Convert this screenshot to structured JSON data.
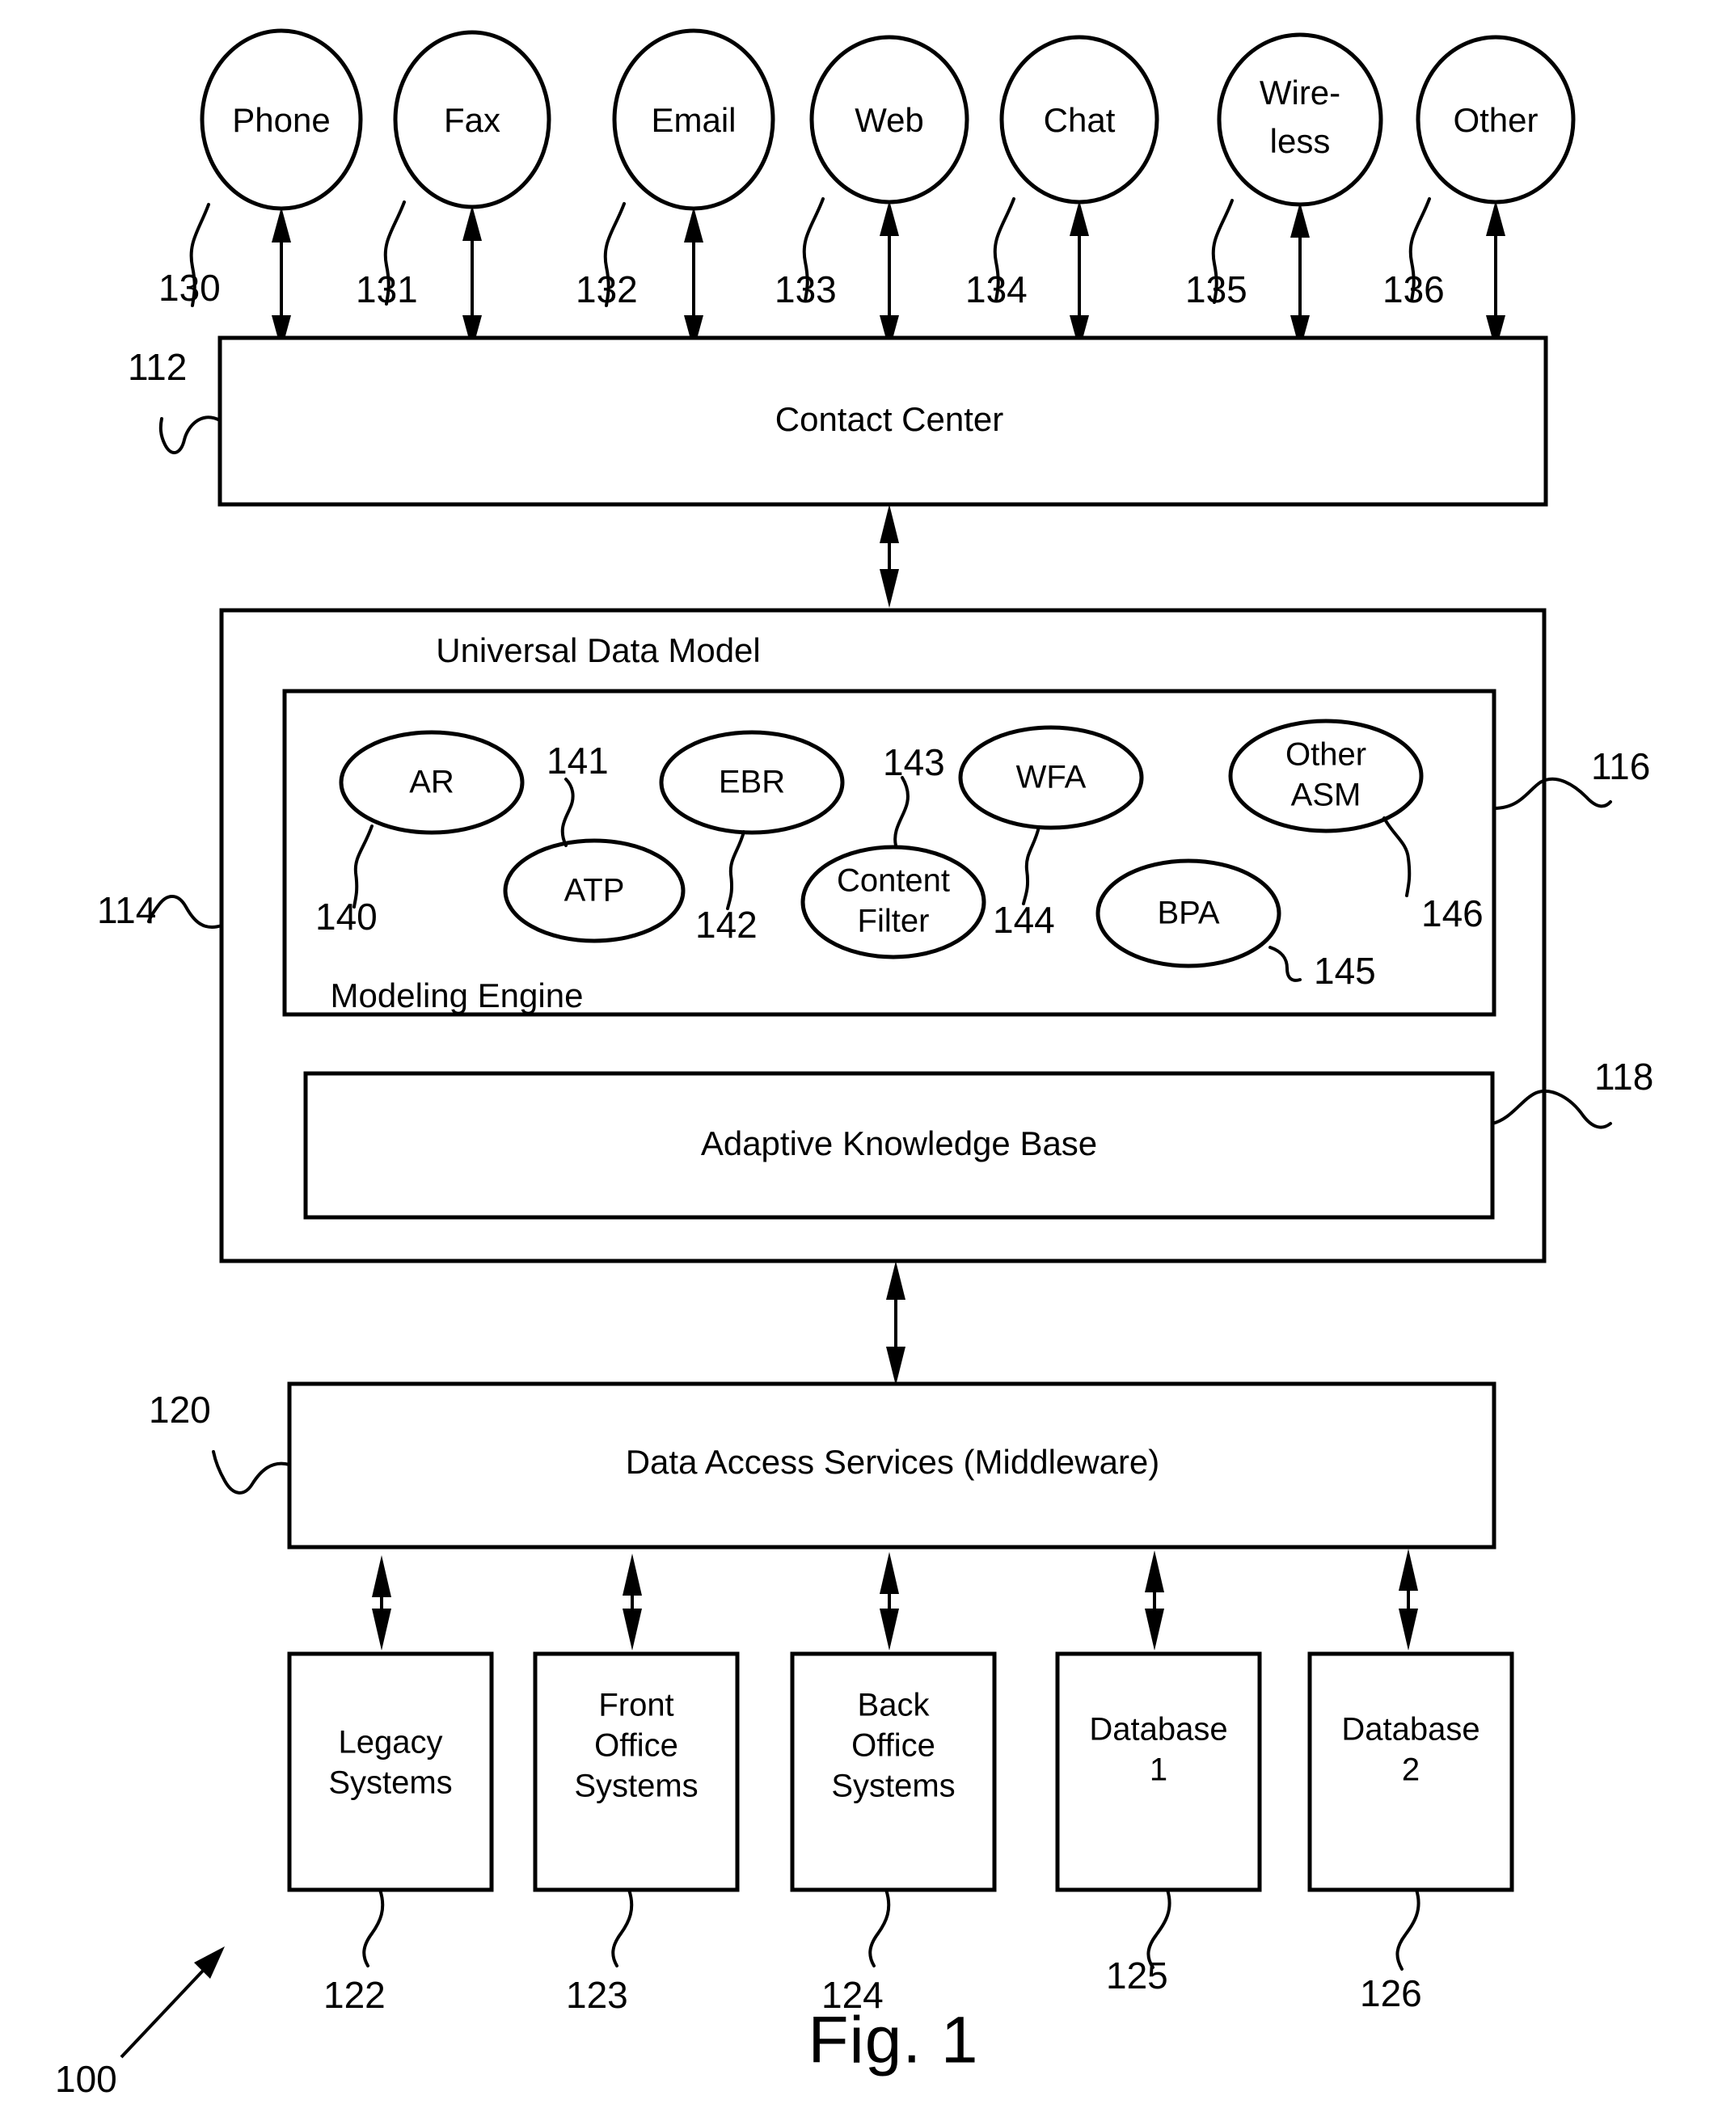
{
  "figure": {
    "caption": "Fig. 1",
    "system_ref": "100"
  },
  "channels": {
    "items": [
      {
        "label": "Phone",
        "ref": "130"
      },
      {
        "label": "Fax",
        "ref": "131"
      },
      {
        "label": "Email",
        "ref": "132"
      },
      {
        "label": "Web",
        "ref": "133"
      },
      {
        "label": "Chat",
        "ref": "134"
      },
      {
        "label": "Wire-",
        "label2": "less",
        "ref": "135"
      },
      {
        "label": "Other",
        "ref": "136"
      }
    ]
  },
  "contact_center": {
    "label": "Contact Center",
    "ref": "112"
  },
  "universal_data_model": {
    "label": "Universal Data Model",
    "ref": "114",
    "modeling_engine": {
      "label": "Modeling Engine",
      "ref": "116",
      "components": [
        {
          "label": "AR",
          "ref": "140"
        },
        {
          "label": "ATP",
          "ref": "141"
        },
        {
          "label": "EBR",
          "ref": "142"
        },
        {
          "label": "Content",
          "label2": "Filter",
          "ref": "143"
        },
        {
          "label": "WFA",
          "ref": "144"
        },
        {
          "label": "BPA",
          "ref": "145"
        },
        {
          "label": "Other",
          "label2": "ASM",
          "ref": "146"
        }
      ]
    },
    "adaptive_knowledge_base": {
      "label": "Adaptive Knowledge Base",
      "ref": "118"
    }
  },
  "data_access_services": {
    "label": "Data Access Services (Middleware)",
    "ref": "120"
  },
  "back_end_systems": {
    "items": [
      {
        "line1": "Legacy",
        "line2": "Systems",
        "line3": "",
        "ref": "122"
      },
      {
        "line1": "Front",
        "line2": "Office",
        "line3": "Systems",
        "ref": "123"
      },
      {
        "line1": "Back",
        "line2": "Office",
        "line3": "Systems",
        "ref": "124"
      },
      {
        "line1": "Database",
        "line2": "1",
        "line3": "",
        "ref": "125"
      },
      {
        "line1": "Database",
        "line2": "2",
        "line3": "",
        "ref": "126"
      }
    ]
  },
  "colors": {
    "ink": "#000000",
    "paper": "#ffffff"
  }
}
